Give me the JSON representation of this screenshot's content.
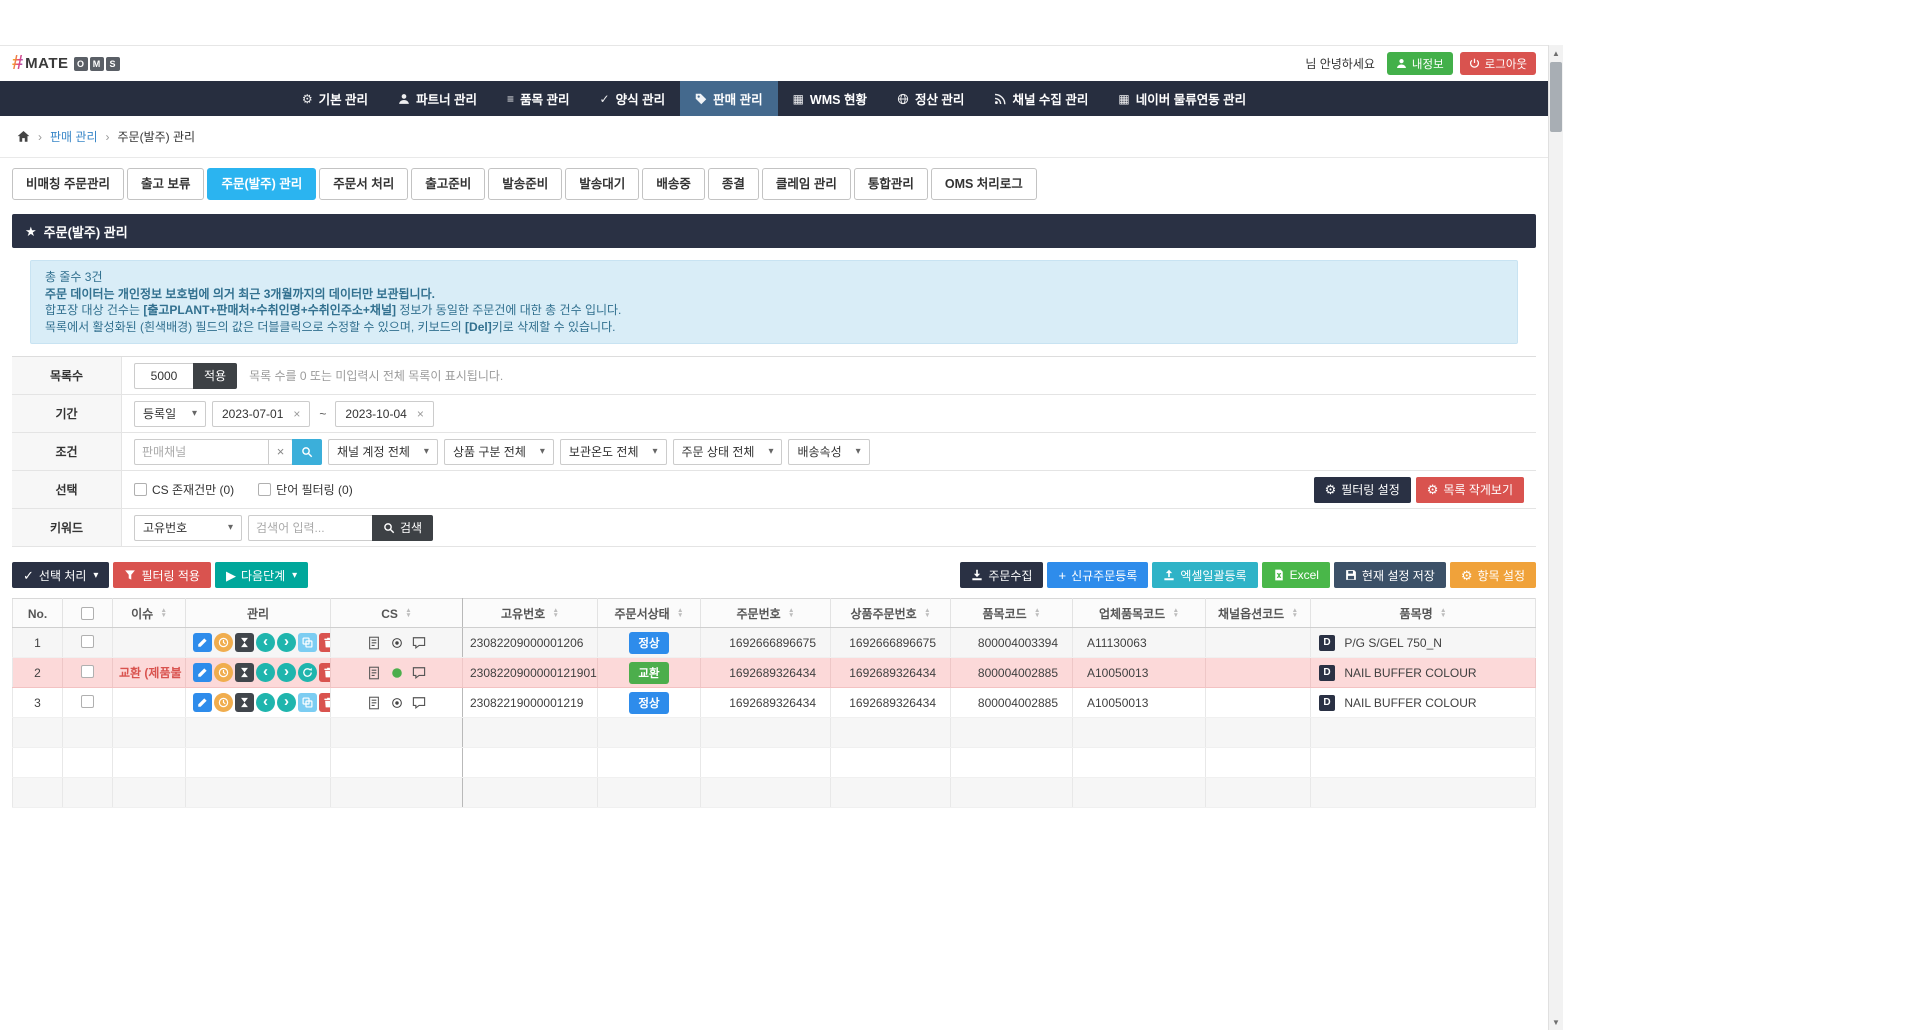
{
  "header": {
    "logo": {
      "hash": "#",
      "text": "MATE",
      "boxed": [
        "O",
        "M",
        "S"
      ]
    },
    "greeting": "님 안녕하세요",
    "buttons": {
      "myinfo": "내정보",
      "logout": "로그아웃"
    }
  },
  "nav": {
    "items": [
      {
        "label": "기본 관리",
        "icon": "gear-icon",
        "active": false
      },
      {
        "label": "파트너 관리",
        "icon": "user-icon",
        "active": false
      },
      {
        "label": "품목 관리",
        "icon": "list-icon",
        "active": false
      },
      {
        "label": "양식 관리",
        "icon": "check-icon",
        "active": false
      },
      {
        "label": "판매 관리",
        "icon": "tag-icon",
        "active": true
      },
      {
        "label": "WMS 현황",
        "icon": "grid-icon",
        "active": false
      },
      {
        "label": "정산 관리",
        "icon": "globe-icon",
        "active": false
      },
      {
        "label": "채널 수집 관리",
        "icon": "rss-icon",
        "active": false
      },
      {
        "label": "네이버 물류연동 관리",
        "icon": "grid-icon",
        "active": false
      }
    ]
  },
  "breadcrumb": {
    "sep": "›",
    "items": [
      "판매 관리",
      "주문(발주) 관리"
    ]
  },
  "tabs": [
    {
      "label": "비매칭 주문관리",
      "active": false
    },
    {
      "label": "출고 보류",
      "active": false
    },
    {
      "label": "주문(발주) 관리",
      "active": true
    },
    {
      "label": "주문서 처리",
      "active": false
    },
    {
      "label": "출고준비",
      "active": false
    },
    {
      "label": "발송준비",
      "active": false
    },
    {
      "label": "발송대기",
      "active": false
    },
    {
      "label": "배송중",
      "active": false
    },
    {
      "label": "종결",
      "active": false
    },
    {
      "label": "클레임 관리",
      "active": false
    },
    {
      "label": "통합관리",
      "active": false
    },
    {
      "label": "OMS 처리로그",
      "active": false
    }
  ],
  "section_title": "주문(발주) 관리",
  "notice": {
    "line1": "총 줄수 3건",
    "line2": "주문 데이터는 개인정보 보호법에 의거 최근 3개월까지의 데이터만 보관됩니다.",
    "line3_pre": "합포장 대상 건수는 ",
    "line3_bold": "[출고PLANT+판매처+수취인명+수취인주소+채널]",
    "line3_post": " 정보가 동일한 주문건에 대한 총 건수 입니다.",
    "line4_pre": "목록에서 활성화된 (흰색배경) 필드의 값은 더블클릭으로 수정할 수 있으며, 키보드의 ",
    "line4_bold": "[Del]",
    "line4_post": "키로 삭제할 수 있습니다."
  },
  "filters": {
    "list_count": {
      "label": "목록수",
      "value": "5000",
      "apply": "적용",
      "hint": "목록 수를 0 또는 미입력시 전체 목록이 표시됩니다."
    },
    "period": {
      "label": "기간",
      "type_select": "등록일",
      "from": "2023-07-01",
      "to": "2023-10-04",
      "tilde": "~",
      "clear": "×"
    },
    "condition": {
      "label": "조건",
      "channel_placeholder": "판매채널",
      "clear": "×",
      "selects": [
        "채널 계정 전체",
        "상품 구분 전체",
        "보관온도 전체",
        "주문 상태 전체",
        "배송속성"
      ]
    },
    "select_row": {
      "label": "선택",
      "cs_checkbox": "CS 존재건만 (0)",
      "word_checkbox": "단어 필터링 (0)",
      "filter_settings": "필터링 설정",
      "compact_view": "목록 작게보기"
    },
    "keyword": {
      "label": "키워드",
      "field_select": "고유번호",
      "placeholder": "검색어 입력...",
      "search": "검색"
    }
  },
  "actions": {
    "left": [
      {
        "label": "선택 처리",
        "icon": "check-icon",
        "caret": true,
        "style": "navy"
      },
      {
        "label": "필터링 적용",
        "icon": "filter-icon",
        "caret": false,
        "style": "red"
      },
      {
        "label": "다음단계",
        "icon": "play-icon",
        "caret": true,
        "style": "teal"
      }
    ],
    "right": [
      {
        "label": "주문수집",
        "icon": "download-icon",
        "style": "navy"
      },
      {
        "label": "신규주문등록",
        "icon": "plus-icon",
        "style": "blue"
      },
      {
        "label": "엑셀일괄등록",
        "icon": "upload-icon",
        "style": "cyan"
      },
      {
        "label": "Excel",
        "icon": "excel-icon",
        "style": "green"
      },
      {
        "label": "현재 설정 저장",
        "icon": "save-icon",
        "style": "slate"
      },
      {
        "label": "항목 설정",
        "icon": "gear-icon",
        "style": "orange"
      }
    ]
  },
  "table": {
    "columns": [
      {
        "label": "No.",
        "sortable": false,
        "checkbox": false
      },
      {
        "label": "",
        "sortable": false,
        "checkbox": true
      },
      {
        "label": "이슈",
        "sortable": true,
        "checkbox": false
      },
      {
        "label": "관리",
        "sortable": false,
        "checkbox": false
      },
      {
        "label": "CS",
        "sortable": true,
        "checkbox": false
      },
      {
        "label": "고유번호",
        "sortable": true,
        "checkbox": false
      },
      {
        "label": "주문서상태",
        "sortable": true,
        "checkbox": false
      },
      {
        "label": "주문번호",
        "sortable": true,
        "checkbox": false
      },
      {
        "label": "상품주문번호",
        "sortable": true,
        "checkbox": false
      },
      {
        "label": "품목코드",
        "sortable": true,
        "checkbox": false
      },
      {
        "label": "업체품목코드",
        "sortable": true,
        "checkbox": false
      },
      {
        "label": "채널옵션코드",
        "sortable": true,
        "checkbox": false
      },
      {
        "label": "품목명",
        "sortable": true,
        "checkbox": false
      }
    ],
    "rows": [
      {
        "no": "1",
        "shade": true,
        "highlight": false,
        "issue": "",
        "mgmt": [
          "pencil-icon",
          "clock-icon",
          "hourglass-icon",
          "prev-icon",
          "next-icon",
          "copy-icon",
          "trash-icon"
        ],
        "cs_dot": "dot-icon",
        "uid": "23082209000001206",
        "status": {
          "label": "정상",
          "type": "normal"
        },
        "order_no": "1692666896675",
        "product_order_no": "1692666896675",
        "item_code": "800004003394",
        "vendor_item_code": "A11130063",
        "channel_option_code": "",
        "type_badge": "D",
        "item_name": "P/G S/GEL 750_N"
      },
      {
        "no": "2",
        "shade": false,
        "highlight": true,
        "issue": "교환 (제품불",
        "mgmt": [
          "pencil-icon",
          "clock-icon",
          "hourglass-icon",
          "prev-icon",
          "next-icon",
          "refresh-icon",
          "trash-icon"
        ],
        "cs_dot": "dot-green-icon",
        "uid": "2308220900000121901",
        "status": {
          "label": "교환",
          "type": "exchange"
        },
        "order_no": "1692689326434",
        "product_order_no": "1692689326434",
        "item_code": "800004002885",
        "vendor_item_code": "A10050013",
        "channel_option_code": "",
        "type_badge": "D",
        "item_name": "NAIL BUFFER COLOUR"
      },
      {
        "no": "3",
        "shade": false,
        "highlight": false,
        "issue": "",
        "mgmt": [
          "pencil-icon",
          "clock-icon",
          "hourglass-icon",
          "prev-icon",
          "next-icon",
          "copy-icon",
          "trash-icon"
        ],
        "cs_dot": "dot-icon",
        "uid": "23082219000001219",
        "status": {
          "label": "정상",
          "type": "normal"
        },
        "order_no": "1692689326434",
        "product_order_no": "1692689326434",
        "item_code": "800004002885",
        "vendor_item_code": "A10050013",
        "channel_option_code": "",
        "type_badge": "D",
        "item_name": "NAIL BUFFER COLOUR"
      }
    ],
    "empty_row_count": 3
  },
  "colors": {
    "nav_bg": "#272e3f",
    "nav_active_bg": "#44698d",
    "section_bg": "#2a3144",
    "tab_active": "#2bb4f0",
    "primary_blue": "#2e8ceb",
    "danger_red": "#d9534f",
    "teal": "#1fb5ad",
    "success_green": "#4cae4c",
    "cyan": "#2fb3c7",
    "orange": "#f0a23a",
    "slate": "#3c5168",
    "notice_bg": "#d9edf7",
    "notice_text": "#31708f",
    "row_highlight": "#fcd9d9"
  }
}
